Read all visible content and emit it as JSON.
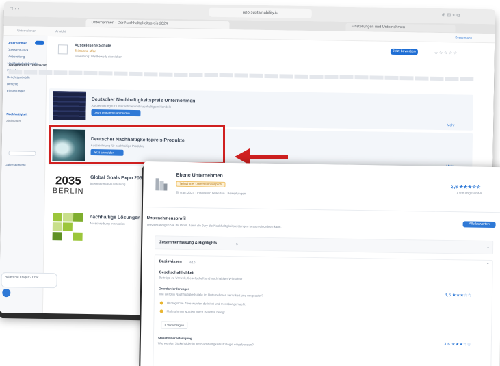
{
  "back_window": {
    "url": "app.sustainability.io",
    "tabs": [
      "Unternehmen - Der Nachhaltigkeitspreis 2024",
      "Einstellungen und Unternehmen"
    ],
    "header": {
      "left": "Unternehmen",
      "right": "Ansicht",
      "user": "Sesselmann"
    },
    "sidebar": [
      "Unternehmen",
      "Übersicht 2024",
      "Vorbereitung",
      "Nachhaltigkeitsbericht",
      "Fragebogen",
      "Berichtsentwürfe",
      "Berichte",
      "Einstellungen",
      "Nachhaltigkeit",
      "Aktivitäten",
      "Jahresberichte"
    ],
    "company_row": {
      "name": "Ausgelesene Schule",
      "badge": "Teilnahme offen",
      "meta": "Bewertung: Wettbewerb einreichen",
      "button": "Jetzt bewerben"
    },
    "section_label": "Ausgewählte Übersicht",
    "cards": [
      {
        "title": "Deutscher Nachhaltigkeitspreis Unternehmen",
        "sub": "Auszeichnung für Unternehmen mit nachhaltigem Handeln",
        "button": "Jetzt Teilnahme anmelden",
        "link": "Mehr"
      },
      {
        "title": "Deutscher Nachhaltigkeitspreis Produkte",
        "sub": "Auszeichnung für nachhaltige Produkte",
        "button": "Jetzt anmelden",
        "link": "Mehr"
      },
      {
        "title": "Global Goals Expo 2035",
        "sub": "Internationale Ausstellung",
        "logo_line1": "2035",
        "logo_line2": "BERLIN"
      },
      {
        "title": "nachhaltige Lösungen",
        "sub": "Ausschreibung Innovation"
      }
    ],
    "chat_text": "Haben Sie Fragen? Chat"
  },
  "front_window": {
    "company": "Ebene Unternehmen",
    "badge": "Teilnahme: Unternehmensprofil",
    "meta": "Eintrag: 2024 · Innovation bewerten · Bewertungen",
    "score": "3,6 ★★★☆☆",
    "score_sub": "1 von insgesamt 4",
    "profile_title": "Unternehmensprofil",
    "profile_text": "Vervollständigen Sie Ihr Profil, damit die Jury die Nachhaltigkeitsleistungen besser einordnen kann.",
    "profile_button": "Alle bewerten",
    "summary_title": "Zusammenfassung & Highlights",
    "summary_count": "5",
    "strategy_title": "Basiswissen",
    "strategy_count": "4/10",
    "subsection_title": "Gesellschaftlichkeit",
    "subsection_text": "Beiträge zu Umwelt, Gesellschaft und nachhaltiger Wirtschaft",
    "item1_title": "Grundanforderungen",
    "item1_text": "Wie werden Nachhaltigkeitsziele im Unternehmen verankert und umgesetzt?",
    "item1_rating": "3,6 ★★★☆☆",
    "bullets": [
      "Ökologische Ziele wurden definiert und messbar gemacht",
      "Maßnahmen wurden durch Berichte belegt"
    ],
    "more_label": "+ Vorschlagen",
    "item2_title": "Stakeholderbeteiligung",
    "item2_text": "Wie werden Stakeholder in die Nachhaltigkeitsstrategie eingebunden?",
    "item2_rating": "3,6 ★★★☆☆"
  },
  "colors": {
    "accent": "#2f79d6",
    "highlight": "#d02020"
  }
}
